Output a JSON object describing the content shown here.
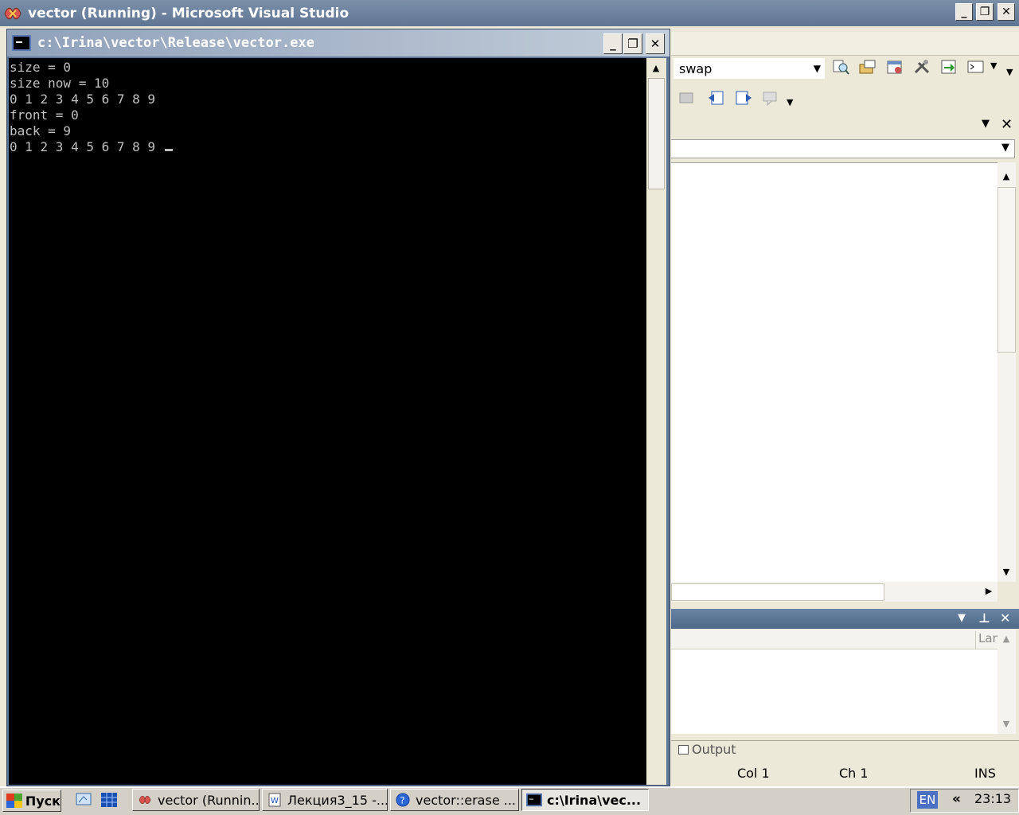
{
  "vs": {
    "title": "vector (Running) - Microsoft Visual Studio",
    "find_combo_value": "swap",
    "output_column_header": "Lan",
    "output_tab_label": "Output",
    "status": {
      "col": "Col 1",
      "ch": "Ch 1",
      "mode": "INS"
    }
  },
  "console": {
    "title": "c:\\Irina\\vector\\Release\\vector.exe",
    "lines": [
      "size = 0",
      "size now = 10",
      "0 1 2 3 4 5 6 7 8 9",
      "front = 0",
      "back = 9",
      "0 1 2 3 4 5 6 7 8 9 "
    ]
  },
  "taskbar": {
    "start_label": "Пуск",
    "tasks": [
      {
        "label": "vector (Runnin...",
        "icon": "visual-studio-icon"
      },
      {
        "label": "Лекция3_15 -...",
        "icon": "word-document-icon"
      },
      {
        "label": "vector::erase ...",
        "icon": "help-icon"
      },
      {
        "label": "c:\\Irina\\vec...",
        "icon": "console-icon"
      }
    ],
    "language": "EN",
    "expand": "«",
    "clock": "23:13"
  },
  "colors": {
    "titlebar": "#5f7694",
    "console_bg": "#000000",
    "console_fg": "#c0c0c0"
  }
}
